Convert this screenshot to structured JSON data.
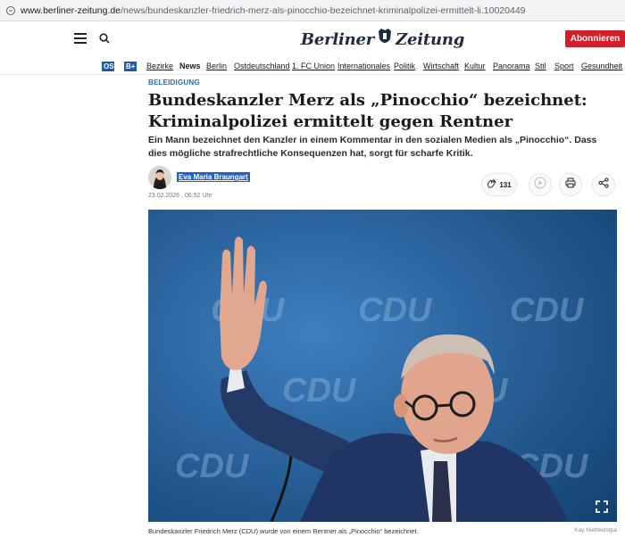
{
  "browser": {
    "url_domain": "www.berliner-zeitung.de",
    "url_path": "/news/bundeskanzler-friedrich-merz-als-pinocchio-bezeichnet-kriminalpolizei-ermittelt-li.10020449"
  },
  "header": {
    "logo_left": "Berliner",
    "logo_right": "Zeitung",
    "subscribe_label": "Abonnieren"
  },
  "nav": {
    "badges": [
      "OS",
      "B+"
    ],
    "items": [
      "Bezirke",
      "News",
      "Berlin",
      "Ostdeutschland",
      "1. FC Union",
      "Internationales",
      "Politik",
      "Wirtschaft",
      "Kultur",
      "Panorama",
      "Stil",
      "Sport",
      "Gesundheit"
    ],
    "active": "News"
  },
  "article": {
    "kicker": "BELEIDIGUNG",
    "headline": "Bundeskanzler Merz als „Pinocchio“ bezeichnet: Kriminalpolizei ermittelt gegen Rentner",
    "teaser": "Ein Mann bezeichnet den Kanzler in einem Kommentar in den sozialen Medien als „Pinocchio“. Dass dies mögliche strafrechtliche Konsequenzen hat, sorgt für scharfe Kritik.",
    "author": "Eva Maria Braungart",
    "date": "23.02.2026 , 06:52 Uhr",
    "likes": "131",
    "image_caption": "Bundeskanzler Friedrich Merz (CDU) wurde von einem Rentner als „Pinocchio“ bezeichnet.",
    "image_credit": "Kay Nietfeld/dpa",
    "backdrop_text": "CDU"
  },
  "colors": {
    "accent_blue": "#2a6bb7",
    "subscribe_red": "#d2202b",
    "logo_navy": "#1f2a44",
    "photo_bg": "#1e5b95"
  }
}
